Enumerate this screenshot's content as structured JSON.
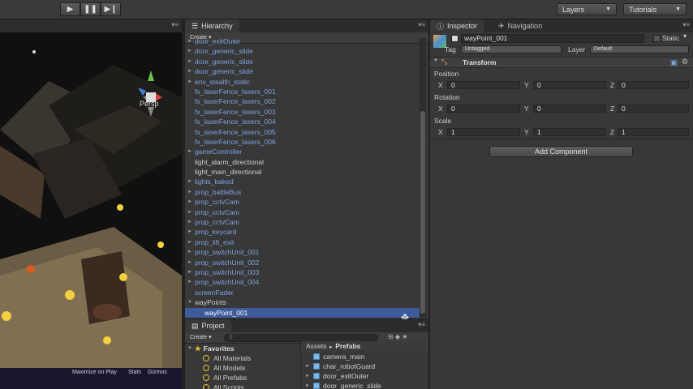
{
  "toolbar": {
    "play_icon": "play-icon",
    "pause_icon": "pause-icon",
    "step_icon": "step-icon",
    "layers_label": "Layers",
    "tutorials_label": "Tutorials"
  },
  "scene": {
    "persp_label": "Persp",
    "maximize_label": "Maximize on Play",
    "stats_label": "Stats",
    "gizmos_label": "Gizmos"
  },
  "hierarchy": {
    "tab_label": "Hierarchy",
    "create_label": "Create",
    "rows": [
      {
        "label": "door_exitOuter",
        "prefab": true,
        "expandable": true
      },
      {
        "label": "door_generic_slide",
        "prefab": true,
        "expandable": true
      },
      {
        "label": "door_generic_slide",
        "prefab": true,
        "expandable": true
      },
      {
        "label": "door_generic_slide",
        "prefab": true,
        "expandable": true
      },
      {
        "label": "env_stealth_static",
        "prefab": true,
        "expandable": true
      },
      {
        "label": "fx_laserFence_lasers_001",
        "prefab": true,
        "expandable": false
      },
      {
        "label": "fx_laserFence_lasers_002",
        "prefab": true,
        "expandable": false
      },
      {
        "label": "fx_laserFence_lasers_003",
        "prefab": true,
        "expandable": false
      },
      {
        "label": "fx_laserFence_lasers_004",
        "prefab": true,
        "expandable": false
      },
      {
        "label": "fx_laserFence_lasers_005",
        "prefab": true,
        "expandable": false
      },
      {
        "label": "fx_laserFence_lasers_006",
        "prefab": true,
        "expandable": false
      },
      {
        "label": "gameController",
        "prefab": true,
        "expandable": true
      },
      {
        "label": "light_alarm_directional",
        "prefab": false,
        "expandable": false
      },
      {
        "label": "light_main_directional",
        "prefab": false,
        "expandable": false
      },
      {
        "label": "lights_baked",
        "prefab": true,
        "expandable": true
      },
      {
        "label": "prop_battleBus",
        "prefab": true,
        "expandable": true
      },
      {
        "label": "prop_cctvCam",
        "prefab": true,
        "expandable": true
      },
      {
        "label": "prop_cctvCam",
        "prefab": true,
        "expandable": true
      },
      {
        "label": "prop_cctvCam",
        "prefab": true,
        "expandable": true
      },
      {
        "label": "prop_keycard",
        "prefab": true,
        "expandable": true
      },
      {
        "label": "prop_lift_exit",
        "prefab": true,
        "expandable": true
      },
      {
        "label": "prop_switchUnit_001",
        "prefab": true,
        "expandable": true
      },
      {
        "label": "prop_switchUnit_002",
        "prefab": true,
        "expandable": true
      },
      {
        "label": "prop_switchUnit_003",
        "prefab": true,
        "expandable": true
      },
      {
        "label": "prop_switchUnit_004",
        "prefab": true,
        "expandable": true
      },
      {
        "label": "screenFader",
        "prefab": true,
        "expandable": false
      },
      {
        "label": "wayPoints",
        "prefab": false,
        "expandable": true,
        "expanded": true
      },
      {
        "label": "wayPoint_001",
        "prefab": false,
        "expandable": false,
        "selected": true,
        "indent": true
      }
    ]
  },
  "project": {
    "tab_label": "Project",
    "create_label": "Create",
    "favorites_label": "Favorites",
    "favorites": [
      "All Materials",
      "All Models",
      "All Prefabs",
      "All Scripts"
    ],
    "breadcrumb_root": "Assets",
    "breadcrumb_sep": "►",
    "breadcrumb_folder": "Prefabs",
    "assets": [
      {
        "label": "camera_main",
        "expandable": false
      },
      {
        "label": "char_robotGuard",
        "expandable": true
      },
      {
        "label": "door_exitOuter",
        "expandable": true
      },
      {
        "label": "door_generic_slide",
        "expandable": true
      }
    ]
  },
  "inspector": {
    "tab_label": "Inspector",
    "nav_tab_label": "Navigation",
    "object_name": "wayPoint_001",
    "static_label": "Static",
    "tag_label": "Tag",
    "tag_value": "Untagged",
    "layer_label": "Layer",
    "layer_value": "Default",
    "component_title": "Transform",
    "position_label": "Position",
    "rotation_label": "Rotation",
    "scale_label": "Scale",
    "axis_x": "X",
    "axis_y": "Y",
    "axis_z": "Z",
    "position": {
      "x": "0",
      "y": "0",
      "z": "0"
    },
    "rotation": {
      "x": "0",
      "y": "0",
      "z": "0"
    },
    "scale": {
      "x": "1",
      "y": "1",
      "z": "1"
    },
    "add_component_label": "Add Component"
  },
  "colors": {
    "selection": "#3d5a9b",
    "prefab_text": "#7fa0e0",
    "panel_bg": "#383838"
  }
}
